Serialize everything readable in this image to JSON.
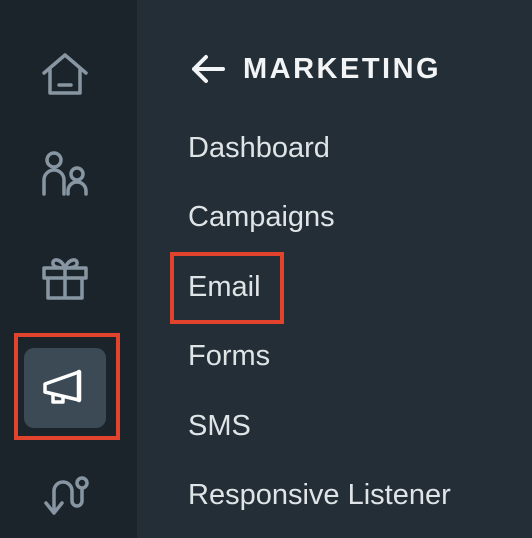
{
  "rail": {
    "icons": [
      {
        "name": "home-icon"
      },
      {
        "name": "people-icon"
      },
      {
        "name": "gift-icon"
      },
      {
        "name": "megaphone-icon",
        "active": true
      },
      {
        "name": "route-icon"
      }
    ]
  },
  "panel": {
    "title": "MARKETING",
    "back_icon": "arrow-left-icon",
    "items": [
      {
        "label": "Dashboard"
      },
      {
        "label": "Campaigns"
      },
      {
        "label": "Email",
        "highlighted": true
      },
      {
        "label": "Forms"
      },
      {
        "label": "SMS"
      },
      {
        "label": "Responsive Listener"
      }
    ]
  },
  "colors": {
    "rail_bg": "#1b242b",
    "panel_bg": "#232e36",
    "active_bg": "#3c4a55",
    "icon": "#8796a2",
    "icon_active": "#ffffff",
    "text": "#dfe4e7",
    "highlight": "#e2432d"
  }
}
